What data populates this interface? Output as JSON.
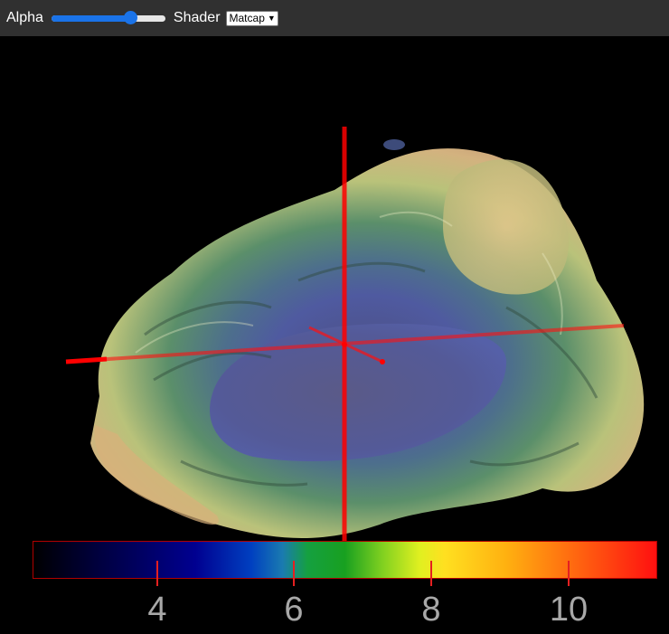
{
  "toolbar": {
    "alpha_label": "Alpha",
    "alpha_value": 0.7,
    "shader_label": "Shader",
    "shader_selected": "Matcap",
    "accent_color": "#1a73e8"
  },
  "viewer": {
    "crosshair_color": "#ff0000"
  },
  "colorbar": {
    "ticks": [
      "4",
      "6",
      "8",
      "10"
    ],
    "border_color": "#b00000"
  }
}
